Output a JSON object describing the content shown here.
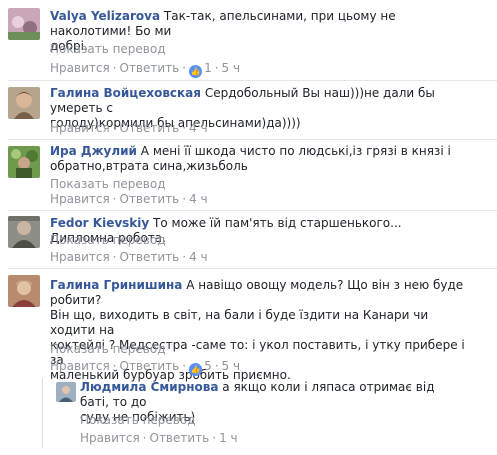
{
  "ui": {
    "translate_label": "Показать перевод",
    "like_label": "Нравится",
    "reply_label": "Ответить",
    "separator": "·"
  },
  "comments": [
    {
      "author": "Valya Yelizarova",
      "text_1": "Так-так, апельсинами, при цьому не наколотими! Бо ми",
      "text_2": "добрі.",
      "translate": "Показать перевод",
      "like_count": "1",
      "time": "5 ч"
    },
    {
      "author": "Галина Войцеховская",
      "text_1": "Сердобольный Вы наш)))не дали бы умереть с",
      "text_2": "голоду)кормили бы апельсинами)да))))",
      "time": "4 ч"
    },
    {
      "author": "Ира Джулий",
      "text_1": "А мені її шкода чисто по людські,із грязі в князі і",
      "text_2": "обратно,втрата сина,жизьболь",
      "translate": "Показать перевод",
      "time": "4 ч"
    },
    {
      "author": "Fedor Kievskiy",
      "text_1": "То може їй пам'ять від старшенького... Дипломна робота.",
      "translate": "Показать перевод",
      "time": "4 ч"
    },
    {
      "author": "Галина Гринишина",
      "text_1": "А навіщо овощу модель? Що він з нею буде робити?",
      "text_2": "Він що, виходить в світ, на бали і буде їздити на Канари чи ходити на",
      "text_3": "коктейлі ? Медсестра -саме то: і укол поставить, і утку прибере і за",
      "text_4": "маленький бурбуар зробить приємно.",
      "translate": "Показать перевод",
      "like_count": "5",
      "time": "5 ч"
    },
    {
      "author": "Людмила Смирнова",
      "text_1": "а якщо коли і ляпаса отримає від баті, то до",
      "text_2": "суду не побіжить)",
      "translate": "Показать перевод",
      "time": "1 ч"
    }
  ]
}
